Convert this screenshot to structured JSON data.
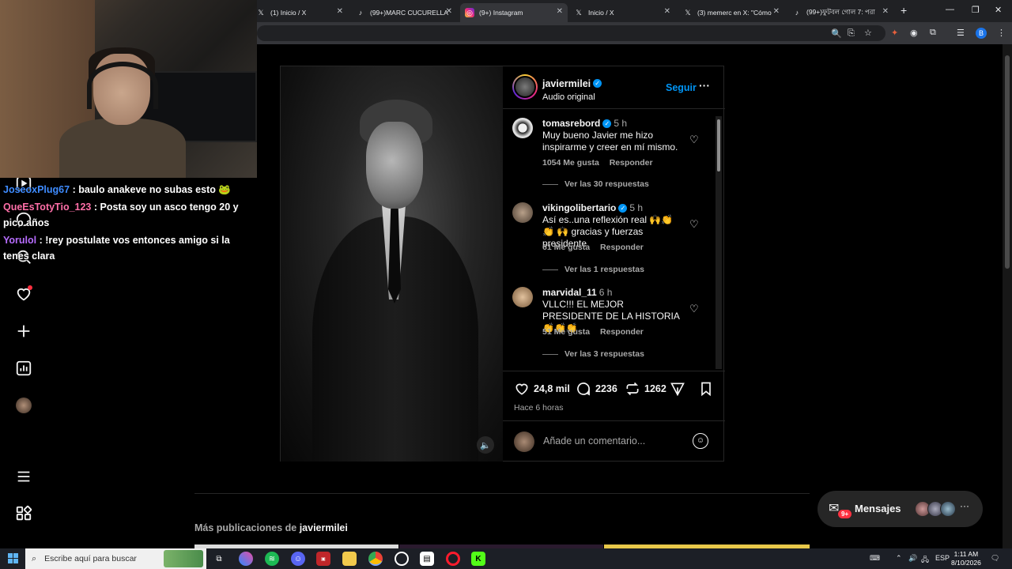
{
  "browser": {
    "tabs": [
      {
        "title": "(1) Inicio / X",
        "icon": "x-icon",
        "active": false
      },
      {
        "title": "(99+)MARC CUCURELLA",
        "icon": "tiktok-icon",
        "active": false
      },
      {
        "title": "(9+) Instagram",
        "icon": "instagram-icon",
        "active": true
      },
      {
        "title": "Inicio / X",
        "icon": "x-icon",
        "active": false
      },
      {
        "title": "(3) memerc en X: \"Cómo",
        "icon": "x-icon",
        "active": false
      },
      {
        "title": "(99+)ফুটবল গোল 7: পরা",
        "icon": "tiktok-icon",
        "active": false
      }
    ],
    "new_tab": "+",
    "profile_initial": "B"
  },
  "chat": [
    {
      "user": "JoseoxPlug67",
      "color": "#3f8cff",
      "text": ": baulo anakeve no subas esto 🐸"
    },
    {
      "user": "QueEsTotyTio_123",
      "color": "#ff6fa8",
      "text": ": Posta soy un asco tengo 20 y pico años"
    },
    {
      "user": "Yorulol",
      "color": "#b76dff",
      "text": ": !rey postulate vos entonces amigo si la tenes clara"
    }
  ],
  "post": {
    "author": "javiermilei",
    "audio": "Audio original",
    "follow": "Seguir",
    "more": "···",
    "comments": [
      {
        "user": "tomasrebord",
        "verified": true,
        "time": "5 h",
        "text": "Muy bueno Javier me hizo inspirarme y creer en mí mismo.",
        "likes": "1054 Me gusta",
        "reply": "Responder",
        "replies": "Ver las 30 respuestas",
        "avatar": "#d9d9d9"
      },
      {
        "user": "vikingolibertario",
        "verified": true,
        "time": "5 h",
        "text": "Así es..una reflexión real 🙌👏👏 🙌 gracias y fuerzas presidente",
        "likes": "61 Me gusta",
        "reply": "Responder",
        "replies": "Ver las 1 respuestas",
        "avatar": "#8a7a6a"
      },
      {
        "user": "marvidal_11",
        "verified": false,
        "time": "6 h",
        "text": "VLLC!!! EL MEJOR PRESIDENTE DE LA HISTORIA 👏👏👏",
        "likes": "51 Me gusta",
        "reply": "Responder",
        "replies": "Ver las 3 respuestas",
        "avatar": "#c8a27a"
      }
    ],
    "likes": "24,8 mil",
    "comment_count": "2236",
    "reposts": "1262",
    "time_ago": "Hace 6 horas",
    "add_comment_placeholder": "Añade un comentario...",
    "mute_icon": "🔈"
  },
  "more_posts": {
    "prefix": "Más publicaciones de",
    "user": "javiermilei"
  },
  "messages": {
    "label": "Mensajes",
    "badge": "9+"
  },
  "taskbar": {
    "search_placeholder": "Escribe aquí para buscar",
    "lang": "ESP",
    "time": "1:11 AM",
    "date": "8/10/2026"
  }
}
